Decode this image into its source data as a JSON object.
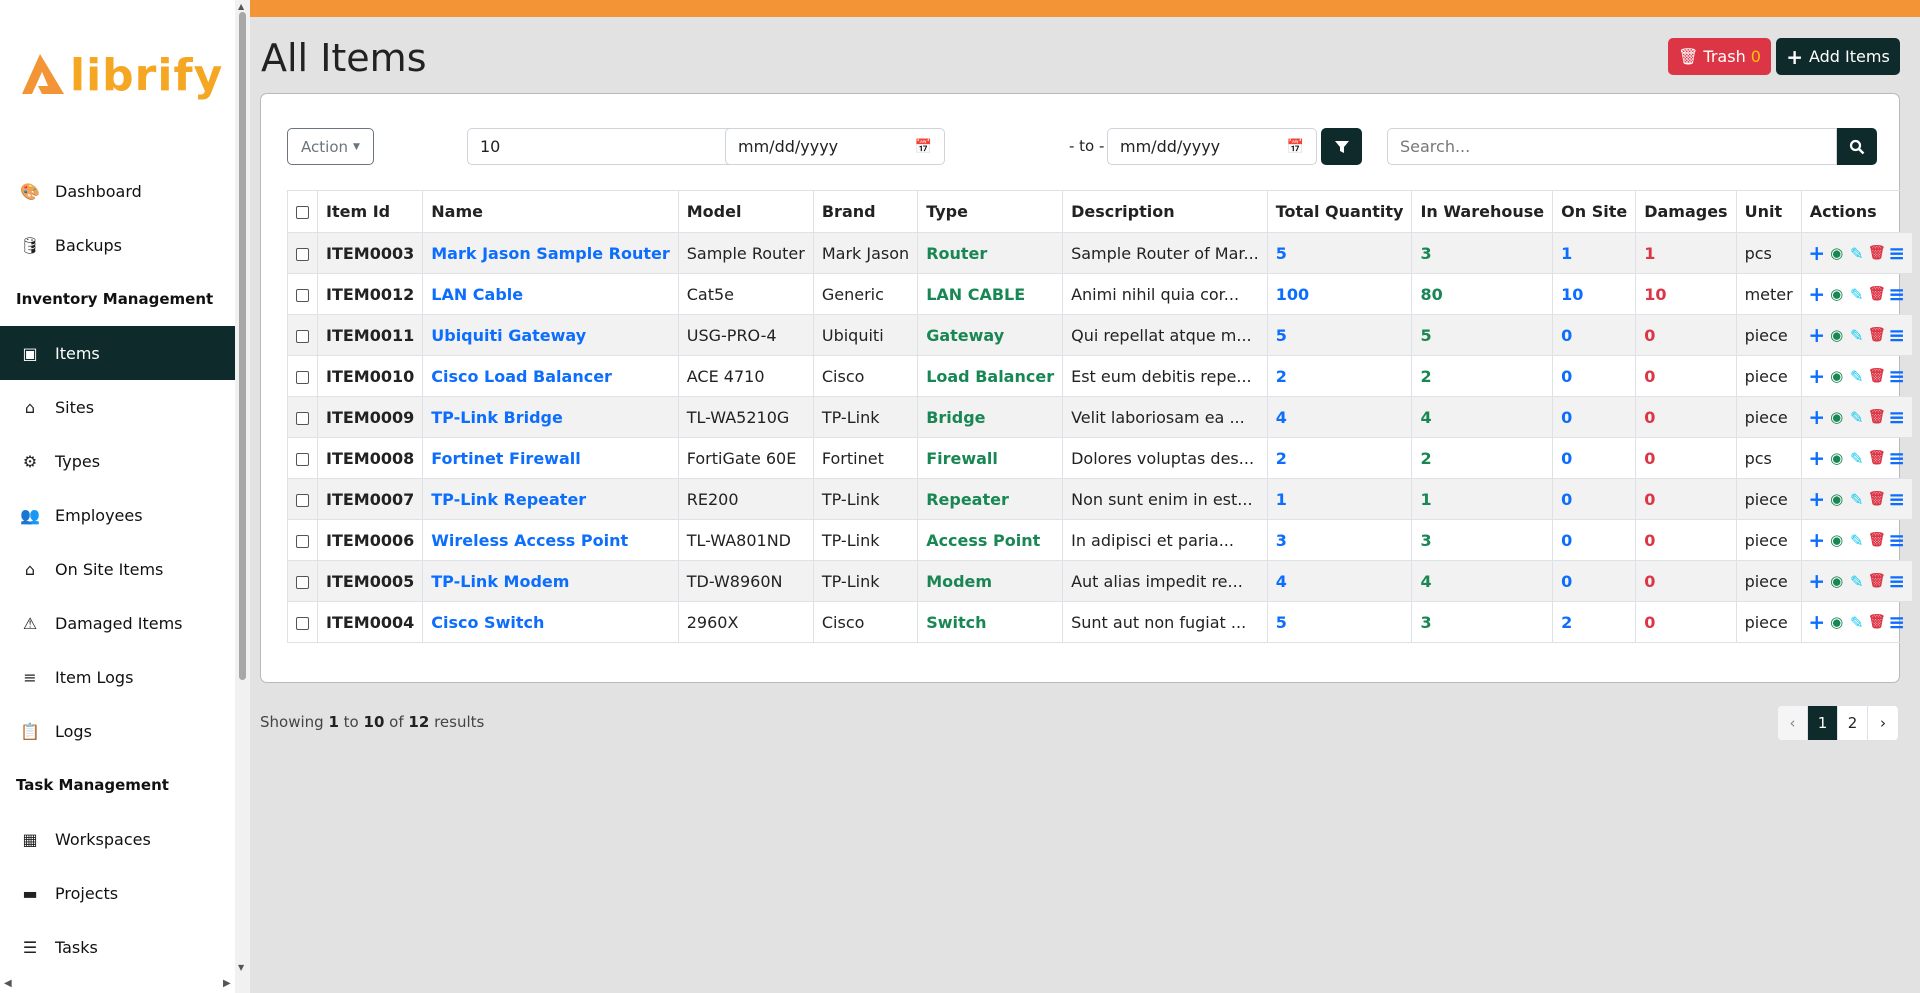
{
  "app": {
    "logo_text": "librify"
  },
  "sidebar": {
    "items": [
      {
        "label": "Dashboard",
        "icon": "palette-icon",
        "glyph": "🎨"
      },
      {
        "label": "Backups",
        "icon": "database-icon",
        "glyph": "🛢"
      },
      {
        "section": "Inventory Management"
      },
      {
        "label": "Items",
        "icon": "box-icon",
        "glyph": "▣",
        "active": true
      },
      {
        "label": "Sites",
        "icon": "home-icon",
        "glyph": "⌂"
      },
      {
        "label": "Types",
        "icon": "gears-icon",
        "glyph": "⚙"
      },
      {
        "label": "Employees",
        "icon": "users-icon",
        "glyph": "👥"
      },
      {
        "label": "On Site Items",
        "icon": "home-icon",
        "glyph": "⌂"
      },
      {
        "label": "Damaged Items",
        "icon": "warning-icon",
        "glyph": "⚠"
      },
      {
        "label": "Item Logs",
        "icon": "list-icon",
        "glyph": "≡"
      },
      {
        "label": "Logs",
        "icon": "clipboard-icon",
        "glyph": "📋"
      },
      {
        "section": "Task Management"
      },
      {
        "label": "Workspaces",
        "icon": "building-icon",
        "glyph": "▦"
      },
      {
        "label": "Projects",
        "icon": "folder-icon",
        "glyph": "▬"
      },
      {
        "label": "Tasks",
        "icon": "checklist-icon",
        "glyph": "☰"
      }
    ]
  },
  "header": {
    "title": "All Items",
    "trash_label": "Trash",
    "trash_count": "0",
    "add_label": "Add Items"
  },
  "filters": {
    "action_label": "Action",
    "per_page": "10",
    "date_from": "mm/dd/yyyy",
    "to_label": "- to -",
    "date_to": "mm/dd/yyyy",
    "search_placeholder": "Search..."
  },
  "table": {
    "columns": [
      "Item Id",
      "Name",
      "Model",
      "Brand",
      "Type",
      "Description",
      "Total Quantity",
      "In Warehouse",
      "On Site",
      "Damages",
      "Unit",
      "Actions"
    ],
    "rows": [
      {
        "id": "ITEM0003",
        "name": "Mark Jason Sample Router",
        "model": "Sample Router",
        "brand": "Mark Jason",
        "type": "Router",
        "desc": "Sample Router of Mar...",
        "total": "5",
        "warehouse": "3",
        "onsite": "1",
        "damages": "1",
        "unit": "pcs"
      },
      {
        "id": "ITEM0012",
        "name": "LAN Cable",
        "model": "Cat5e",
        "brand": "Generic",
        "type": "LAN CABLE",
        "desc": "Animi nihil quia cor...",
        "total": "100",
        "warehouse": "80",
        "onsite": "10",
        "damages": "10",
        "unit": "meter"
      },
      {
        "id": "ITEM0011",
        "name": "Ubiquiti Gateway",
        "model": "USG-PRO-4",
        "brand": "Ubiquiti",
        "type": "Gateway",
        "desc": "Qui repellat atque m...",
        "total": "5",
        "warehouse": "5",
        "onsite": "0",
        "damages": "0",
        "unit": "piece"
      },
      {
        "id": "ITEM0010",
        "name": "Cisco Load Balancer",
        "model": "ACE 4710",
        "brand": "Cisco",
        "type": "Load Balancer",
        "desc": "Est eum debitis repe...",
        "total": "2",
        "warehouse": "2",
        "onsite": "0",
        "damages": "0",
        "unit": "piece"
      },
      {
        "id": "ITEM0009",
        "name": "TP-Link Bridge",
        "model": "TL-WA5210G",
        "brand": "TP-Link",
        "type": "Bridge",
        "desc": "Velit laboriosam ea ...",
        "total": "4",
        "warehouse": "4",
        "onsite": "0",
        "damages": "0",
        "unit": "piece"
      },
      {
        "id": "ITEM0008",
        "name": "Fortinet Firewall",
        "model": "FortiGate 60E",
        "brand": "Fortinet",
        "type": "Firewall",
        "desc": "Dolores voluptas des...",
        "total": "2",
        "warehouse": "2",
        "onsite": "0",
        "damages": "0",
        "unit": "pcs"
      },
      {
        "id": "ITEM0007",
        "name": "TP-Link Repeater",
        "model": "RE200",
        "brand": "TP-Link",
        "type": "Repeater",
        "desc": "Non sunt enim in est...",
        "total": "1",
        "warehouse": "1",
        "onsite": "0",
        "damages": "0",
        "unit": "piece"
      },
      {
        "id": "ITEM0006",
        "name": "Wireless Access Point",
        "model": "TL-WA801ND",
        "brand": "TP-Link",
        "type": "Access Point",
        "desc": "In adipisci et paria...",
        "total": "3",
        "warehouse": "3",
        "onsite": "0",
        "damages": "0",
        "unit": "piece"
      },
      {
        "id": "ITEM0005",
        "name": "TP-Link Modem",
        "model": "TD-W8960N",
        "brand": "TP-Link",
        "type": "Modem",
        "desc": "Aut alias impedit re...",
        "total": "4",
        "warehouse": "4",
        "onsite": "0",
        "damages": "0",
        "unit": "piece"
      },
      {
        "id": "ITEM0004",
        "name": "Cisco Switch",
        "model": "2960X",
        "brand": "Cisco",
        "type": "Switch",
        "desc": "Sunt aut non fugiat ...",
        "total": "5",
        "warehouse": "3",
        "onsite": "2",
        "damages": "0",
        "unit": "piece"
      }
    ]
  },
  "footer": {
    "showing_prefix": "Showing",
    "from": "1",
    "to_word": "to",
    "to": "10",
    "of_word": "of",
    "total": "12",
    "suffix": "results",
    "pages": [
      "‹",
      "1",
      "2",
      "›"
    ],
    "current_page": "1"
  },
  "colors": {
    "accent": "#f39536",
    "dark": "#0f2a2a",
    "danger": "#dc3545",
    "link": "#0d6efd",
    "success": "#198754"
  }
}
